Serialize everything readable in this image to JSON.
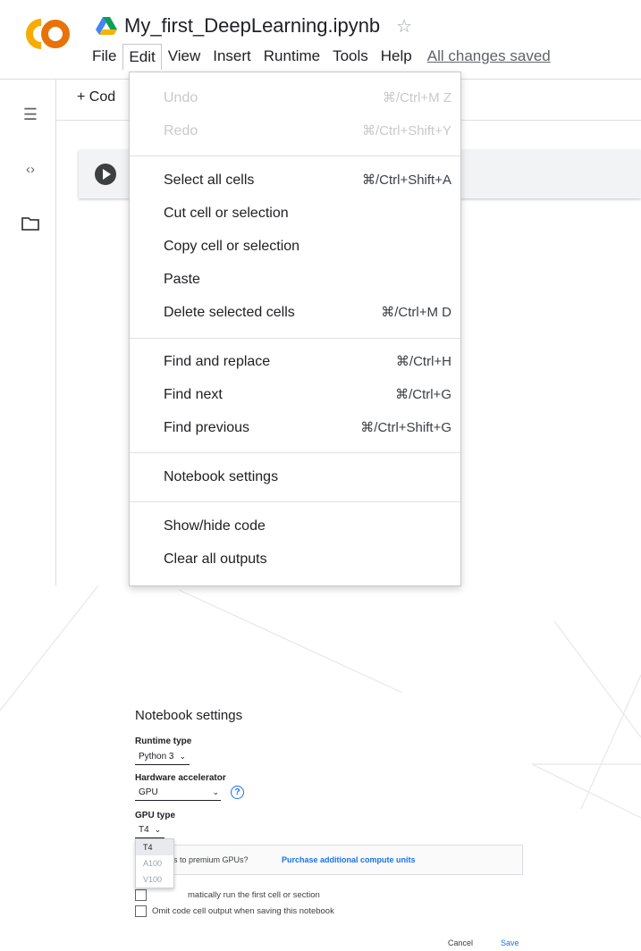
{
  "app": {
    "logo": "colab-co-logo",
    "title": "My_first_DeepLearning.ipynb",
    "star_icon": "star-outline-icon"
  },
  "menubar": {
    "items": [
      "File",
      "Edit",
      "View",
      "Insert",
      "Runtime",
      "Tools",
      "Help"
    ],
    "active": "Edit",
    "status": "All changes saved"
  },
  "toolbar": {
    "add_code": "+ Cod"
  },
  "edit_menu": {
    "items": [
      {
        "label": "Undo",
        "shortcut": "⌘/Ctrl+M Z",
        "disabled": true
      },
      {
        "label": "Redo",
        "shortcut": "⌘/Ctrl+Shift+Y",
        "disabled": true
      },
      {
        "label": "Select all cells",
        "shortcut": "⌘/Ctrl+Shift+A"
      },
      {
        "label": "Cut cell or selection",
        "shortcut": ""
      },
      {
        "label": "Copy cell or selection",
        "shortcut": ""
      },
      {
        "label": "Paste",
        "shortcut": ""
      },
      {
        "label": "Delete selected cells",
        "shortcut": "⌘/Ctrl+M D"
      },
      {
        "label": "Find and replace",
        "shortcut": "⌘/Ctrl+H"
      },
      {
        "label": "Find next",
        "shortcut": "⌘/Ctrl+G"
      },
      {
        "label": "Find previous",
        "shortcut": "⌘/Ctrl+Shift+G"
      },
      {
        "label": "Notebook settings",
        "shortcut": ""
      },
      {
        "label": "Show/hide code",
        "shortcut": ""
      },
      {
        "label": "Clear all outputs",
        "shortcut": ""
      }
    ]
  },
  "dialog": {
    "title": "Notebook settings",
    "runtime_type_label": "Runtime type",
    "runtime_type_value": "Python 3",
    "hw_accel_label": "Hardware accelerator",
    "hw_accel_value": "GPU",
    "gpu_type_label": "GPU type",
    "gpu_type_value": "T4",
    "gpu_options": [
      "T4",
      "A100",
      "V100"
    ],
    "promo_text": "cess to premium GPUs?",
    "promo_link": "Purchase additional compute units",
    "auto_run_text": "matically run the first cell or section",
    "omit_output_text": "Omit code cell output when saving this notebook",
    "cancel": "Cancel",
    "save": "Save"
  },
  "colors": {
    "accent": "#1a73e8",
    "logo_orange": "#f9ab00",
    "logo_dark_orange": "#e8710a"
  }
}
